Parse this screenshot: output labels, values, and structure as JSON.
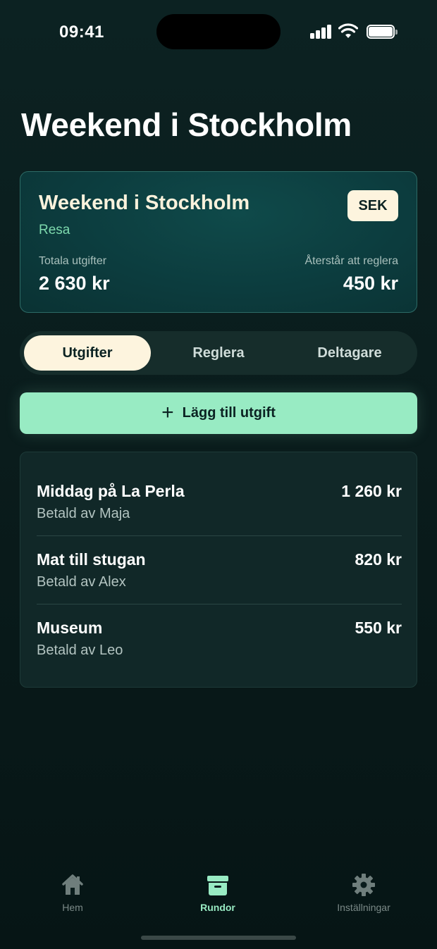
{
  "status_bar": {
    "time": "09:41"
  },
  "page_title": "Weekend i Stockholm",
  "trip_card": {
    "name": "Weekend i Stockholm",
    "type": "Resa",
    "currency": "SEK",
    "total_label": "Totala utgifter",
    "total_value": "2 630 kr",
    "remaining_label": "Återstår att reglera",
    "remaining_value": "450 kr"
  },
  "tabs": [
    {
      "label": "Utgifter",
      "active": true
    },
    {
      "label": "Reglera",
      "active": false
    },
    {
      "label": "Deltagare",
      "active": false
    }
  ],
  "add_button": {
    "label": "Lägg till utgift"
  },
  "expenses": [
    {
      "title": "Middag på La Perla",
      "paid_by": "Betald av Maja",
      "amount": "1 260 kr"
    },
    {
      "title": "Mat till stugan",
      "paid_by": "Betald av Alex",
      "amount": "820 kr"
    },
    {
      "title": "Museum",
      "paid_by": "Betald av Leo",
      "amount": "550 kr"
    }
  ],
  "bottom_nav": [
    {
      "label": "Hem",
      "icon": "home-icon",
      "active": false
    },
    {
      "label": "Rundor",
      "icon": "archive-box-icon",
      "active": true
    },
    {
      "label": "Inställningar",
      "icon": "gear-icon",
      "active": false
    }
  ],
  "colors": {
    "accent": "#98ebc3",
    "cream": "#fdf4de",
    "background": "#0a1c1c"
  }
}
